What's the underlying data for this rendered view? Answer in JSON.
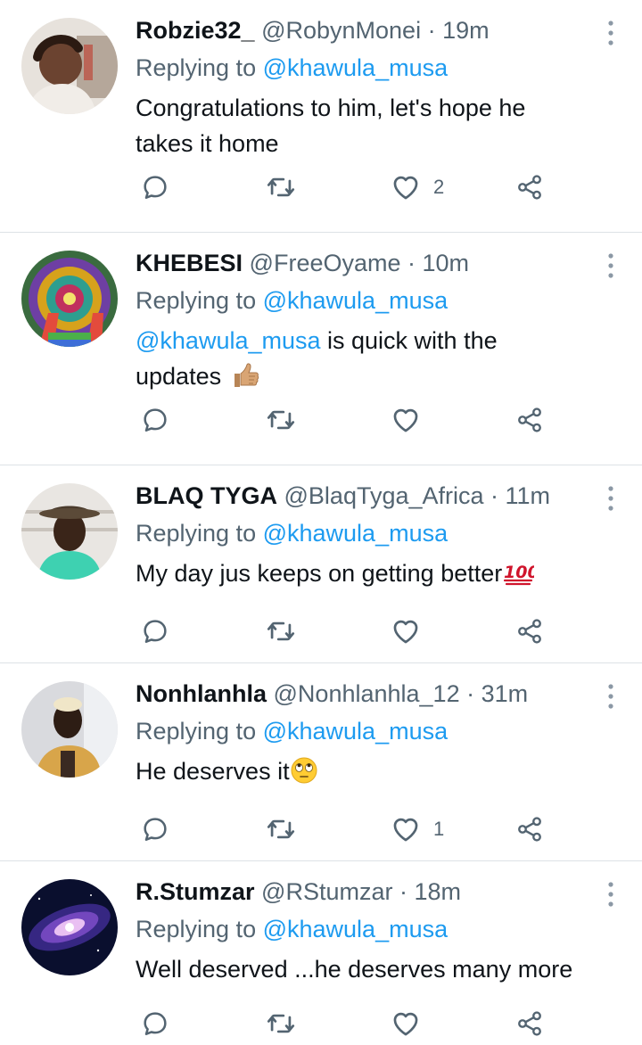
{
  "tweets": [
    {
      "name": "Robzie32_",
      "handle": "@RobynMonei",
      "sep": " · ",
      "time": "19m",
      "replying_prefix": "Replying to ",
      "replying_to": "@khawula_musa",
      "text_line1": "Congratulations to him, let's hope he",
      "text_line2": "takes it home",
      "like_count": "2"
    },
    {
      "name": "KHEBESI",
      "handle": "@FreeOyame",
      "sep": " · ",
      "time": "10m",
      "replying_prefix": "Replying to ",
      "replying_to": "@khawula_musa",
      "text_mention": "@khawula_musa",
      "text_line1_rest": " is quick with the",
      "text_line2": "updates",
      "emoji": "thumbs-up",
      "like_count": ""
    },
    {
      "name": "BLAQ TYGA",
      "handle": "@BlaqTyga_Africa",
      "sep": " · ",
      "time": "11m",
      "replying_prefix": "Replying to ",
      "replying_to": "@khawula_musa",
      "text_line1": "My day jus keeps on getting better",
      "emoji": "hundred-points",
      "like_count": ""
    },
    {
      "name": "Nonhlanhla",
      "handle": "@Nonhlanhla_12",
      "sep": " · ",
      "time": "31m",
      "replying_prefix": "Replying to ",
      "replying_to": "@khawula_musa",
      "text_line1": "He deserves it",
      "emoji": "eye-roll-face",
      "like_count": "1"
    },
    {
      "name": "R.Stumzar",
      "handle": "@RStumzar",
      "sep": " · ",
      "time": "18m",
      "replying_prefix": "Replying to ",
      "replying_to": "@khawula_musa",
      "text_line1": "Well deserved ...he deserves many more",
      "like_count": ""
    }
  ],
  "colors": {
    "text": "#0f1419",
    "secondary": "#536471",
    "link": "#1d9bf0",
    "divider": "#dde2e6"
  },
  "icons": {
    "reply": "reply-icon",
    "retweet": "retweet-icon",
    "like": "like-icon",
    "share": "share-icon",
    "more": "more-vertical-icon"
  }
}
